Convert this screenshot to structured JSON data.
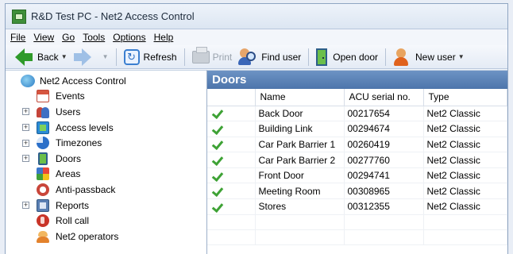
{
  "window": {
    "title": "R&D Test PC - Net2 Access Control",
    "icon": "net2-app-icon"
  },
  "menu": {
    "items": [
      "File",
      "View",
      "Go",
      "Tools",
      "Options",
      "Help"
    ]
  },
  "toolbar": {
    "back_label": "Back",
    "refresh_label": "Refresh",
    "print_label": "Print",
    "find_user_label": "Find user",
    "open_door_label": "Open door",
    "new_user_label": "New user"
  },
  "tree": {
    "root_label": "Net2 Access Control",
    "items": [
      {
        "label": "Events",
        "expandable": false,
        "icon": "events-icon"
      },
      {
        "label": "Users",
        "expandable": true,
        "icon": "users-icon"
      },
      {
        "label": "Access levels",
        "expandable": true,
        "icon": "access-levels-icon"
      },
      {
        "label": "Timezones",
        "expandable": true,
        "icon": "timezones-icon"
      },
      {
        "label": "Doors",
        "expandable": true,
        "icon": "doors-icon"
      },
      {
        "label": "Areas",
        "expandable": false,
        "icon": "areas-icon"
      },
      {
        "label": "Anti-passback",
        "expandable": false,
        "icon": "anti-passback-icon"
      },
      {
        "label": "Reports",
        "expandable": true,
        "icon": "reports-icon"
      },
      {
        "label": "Roll call",
        "expandable": false,
        "icon": "roll-call-icon"
      },
      {
        "label": "Net2 operators",
        "expandable": false,
        "icon": "operators-icon"
      }
    ]
  },
  "doors_panel": {
    "title": "Doors",
    "columns": [
      "",
      "Name",
      "ACU serial no.",
      "Type"
    ],
    "rows": [
      {
        "name": "Back Door",
        "serial": "00217654",
        "type": "Net2 Classic"
      },
      {
        "name": "Building Link",
        "serial": "00294674",
        "type": "Net2 Classic"
      },
      {
        "name": "Car Park Barrier 1",
        "serial": "00260419",
        "type": "Net2 Classic"
      },
      {
        "name": "Car Park Barrier 2",
        "serial": "00277760",
        "type": "Net2 Classic"
      },
      {
        "name": "Front Door",
        "serial": "00294741",
        "type": "Net2 Classic"
      },
      {
        "name": "Meeting Room",
        "serial": "00308965",
        "type": "Net2 Classic"
      },
      {
        "name": "Stores",
        "serial": "00312355",
        "type": "Net2 Classic"
      }
    ]
  },
  "colors": {
    "panel_header": "#5a80b6",
    "check_green": "#3ea235",
    "door_green": "#6bbf4a"
  }
}
